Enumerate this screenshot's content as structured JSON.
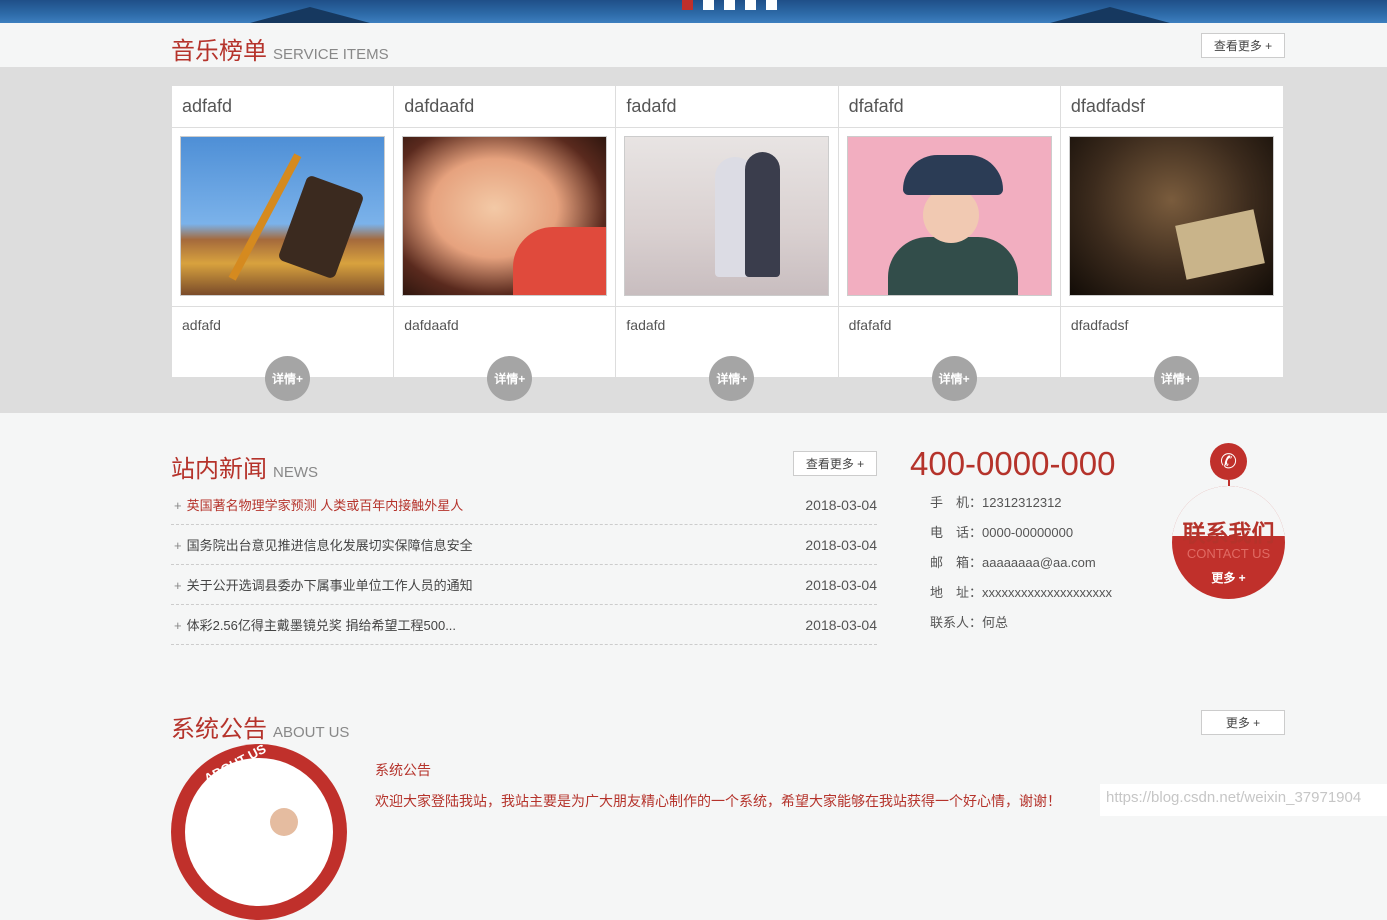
{
  "banner": {
    "active_dot": 0,
    "dot_count": 5
  },
  "music": {
    "title": "音乐榜单",
    "subtitle": "SERVICE ITEMS",
    "more_label": "查看更多 +",
    "detail_label": "详情+",
    "items": [
      {
        "title": "adfafd",
        "name": "adfafd"
      },
      {
        "title": "dafdaafd",
        "name": "dafdaafd"
      },
      {
        "title": "fadafd",
        "name": "fadafd"
      },
      {
        "title": "dfafafd",
        "name": "dfafafd"
      },
      {
        "title": "dfadfadsf",
        "name": "dfadfadsf"
      }
    ]
  },
  "news": {
    "title": "站内新闻",
    "subtitle": "NEWS",
    "more_label": "查看更多 +",
    "items": [
      {
        "text": "英国著名物理学家预测 人类或百年内接触外星人",
        "date": "2018-03-04"
      },
      {
        "text": "国务院出台意见推进信息化发展切实保障信息安全",
        "date": "2018-03-04"
      },
      {
        "text": "关于公开选调县委办下属事业单位工作人员的通知",
        "date": "2018-03-04"
      },
      {
        "text": "体彩2.56亿得主戴墨镜兑奖 捐给希望工程500...",
        "date": "2018-03-04"
      }
    ]
  },
  "contact": {
    "phone": "400-0000-000",
    "mobile": "手　机：12312312312",
    "tel": "电　话：0000-00000000",
    "email": "邮　箱：aaaaaaaa@aa.com",
    "address": "地　址：xxxxxxxxxxxxxxxxxxxx",
    "person": "联系人：何总",
    "badge_title": "联系我们",
    "badge_sub": "CONTACT US",
    "badge_more": "更多 +"
  },
  "about": {
    "title": "系统公告",
    "subtitle": "ABOUT US",
    "more_label": "更多 +",
    "circle_label": "ABOUT US",
    "heading": "系统公告",
    "text": "欢迎大家登陆我站，我站主要是为广大朋友精心制作的一个系统，希望大家能够在我站获得一个好心情，谢谢！"
  },
  "watermark": "https://blog.csdn.net/weixin_37971904",
  "colors": {
    "accent": "#b5332b",
    "band": "#dddddd",
    "detail": "#a5a5a5"
  }
}
